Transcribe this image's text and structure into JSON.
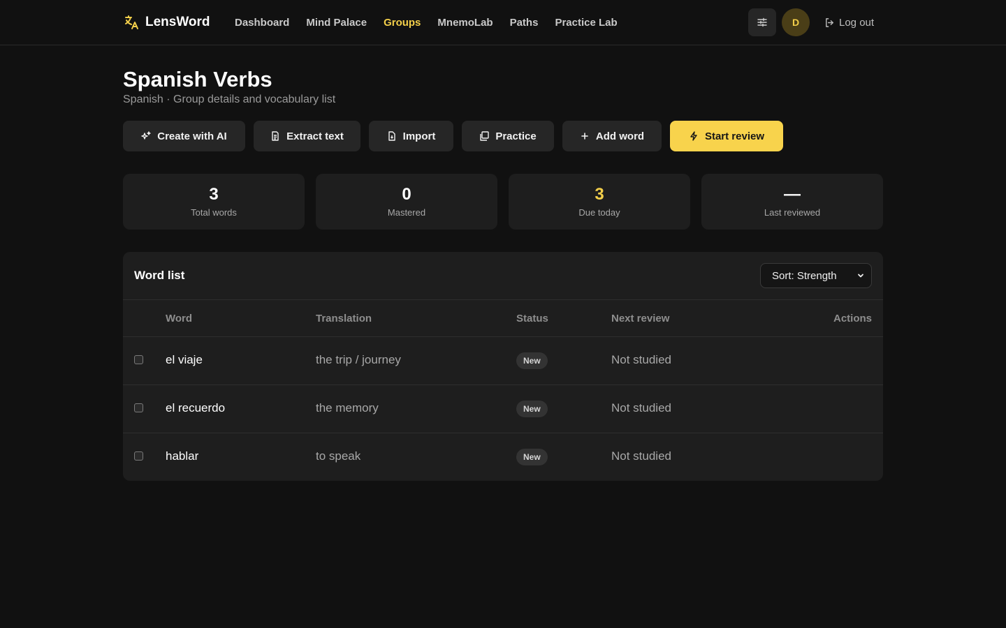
{
  "brand": {
    "name": "LensWord",
    "accent": "#f3cf4a"
  },
  "nav": {
    "items": [
      {
        "label": "Dashboard",
        "active": false
      },
      {
        "label": "Mind Palace",
        "active": false
      },
      {
        "label": "Groups",
        "active": true
      },
      {
        "label": "MnemoLab",
        "active": false
      },
      {
        "label": "Paths",
        "active": false
      },
      {
        "label": "Practice Lab",
        "active": false
      }
    ],
    "avatar_initial": "D",
    "logout_label": "Log out",
    "settings_icon": "sliders-icon"
  },
  "header": {
    "title": "Spanish Verbs",
    "subtitle": "Spanish · Group details and vocabulary list"
  },
  "actions": {
    "create_ai": "Create with AI",
    "extract_text": "Extract text",
    "import": "Import",
    "practice": "Practice",
    "add_word": "Add word",
    "start_review": "Start review"
  },
  "stats": [
    {
      "value": "3",
      "label": "Total words"
    },
    {
      "value": "0",
      "label": "Mastered"
    },
    {
      "value": "3",
      "label": "Due today"
    },
    {
      "value": "—",
      "label": "Last reviewed"
    }
  ],
  "word_list": {
    "title": "Word list",
    "sort_selected": "Sort: Strength",
    "columns": {
      "word": "Word",
      "translation": "Translation",
      "status": "Status",
      "next_review": "Next review",
      "actions": "Actions"
    },
    "rows": [
      {
        "word": "el viaje",
        "translation": "the trip / journey",
        "status": "New",
        "next_review": "Not studied"
      },
      {
        "word": "el recuerdo",
        "translation": "the memory",
        "status": "New",
        "next_review": "Not studied"
      },
      {
        "word": "hablar",
        "translation": "to speak",
        "status": "New",
        "next_review": "Not studied"
      }
    ]
  }
}
